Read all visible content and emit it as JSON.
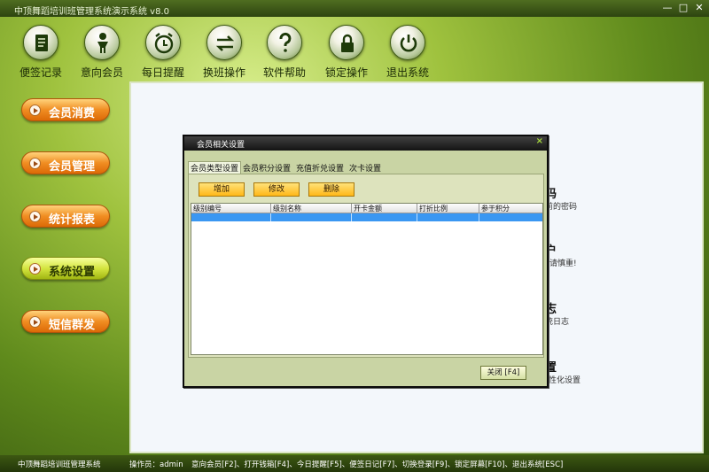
{
  "window": {
    "title": "中顶舞蹈培训班管理系统演示系统   v8.0",
    "minimize_glyph": "—",
    "maximize_glyph": "□",
    "close_glyph": "✕"
  },
  "toolbar": {
    "items": [
      {
        "label": "便签记录",
        "icon": "notepad-icon"
      },
      {
        "label": "意向会员",
        "icon": "member-person-icon"
      },
      {
        "label": "每日提醒",
        "icon": "alarm-clock-icon"
      },
      {
        "label": "换班操作",
        "icon": "swap-arrows-icon"
      },
      {
        "label": "软件帮助",
        "icon": "help-question-icon"
      },
      {
        "label": "锁定操作",
        "icon": "lock-icon"
      },
      {
        "label": "退出系统",
        "icon": "power-icon"
      }
    ]
  },
  "sidebar": {
    "buttons": [
      {
        "label": "会员消费",
        "style": "orange"
      },
      {
        "label": "会员管理",
        "style": "orange"
      },
      {
        "label": "统计报表",
        "style": "orange"
      },
      {
        "label": "系统设置",
        "style": "green"
      },
      {
        "label": "短信群发",
        "style": "orange"
      }
    ]
  },
  "background_panel": {
    "fragments": [
      {
        "text": "码",
        "big": true
      },
      {
        "text": "前的密码",
        "big": false
      },
      {
        "text": "户",
        "big": true
      },
      {
        "text": "请慎重!",
        "big": false
      },
      {
        "text": "志",
        "big": true
      },
      {
        "text": "统日志",
        "big": false
      },
      {
        "text": "置",
        "big": true
      },
      {
        "text": "个性化设置",
        "big": false
      }
    ]
  },
  "dialog": {
    "title": "会员相关设置",
    "close_glyph": "×",
    "tabs": [
      "会员类型设置",
      "会员积分设置",
      "充值折兑设置",
      "次卡设置"
    ],
    "active_tab": "会员类型设置",
    "actions": {
      "add": "增加",
      "edit": "修改",
      "delete": "删除"
    },
    "table": {
      "columns": [
        "级别编号",
        "级别名称",
        "开卡金额",
        "打折比例",
        "参于积分"
      ],
      "rows": []
    },
    "close_button": "关闭 [F4]"
  },
  "statusbar": {
    "system_name": "中顶舞蹈培训班管理系统",
    "operator": "操作员：admin",
    "shortcuts": "意向会员[F2]、打开钱箱[F4]、今日提醒[F5]、便签日记[F7]、切换登录[F9]、锁定屏幕[F10]、退出系统[ESC]"
  },
  "colors": {
    "accent_orange": "#f08d22",
    "accent_green": "#d4e540",
    "selection_blue": "#3a97f2"
  }
}
